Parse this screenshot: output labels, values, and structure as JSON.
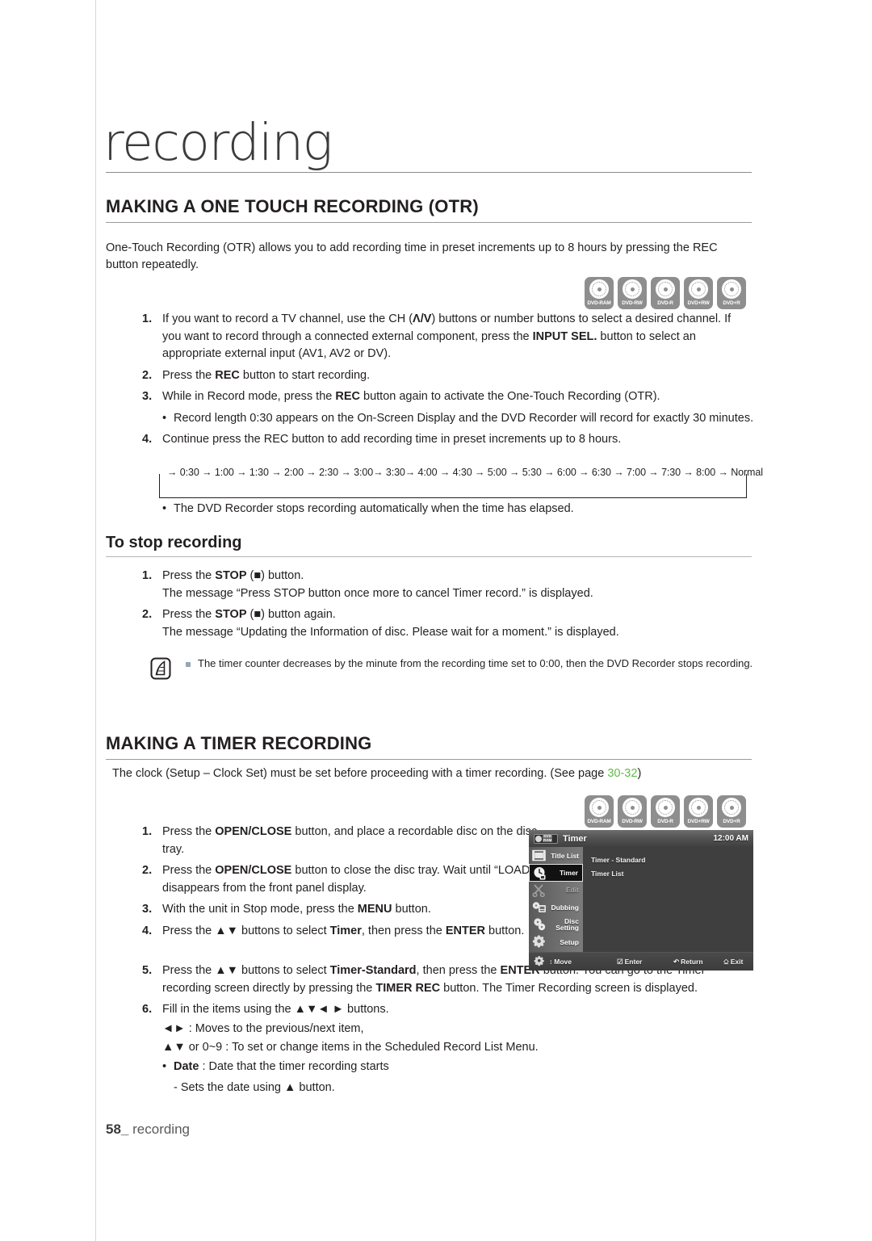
{
  "page": {
    "chapter_title": "recording",
    "footer_page": "58",
    "footer_label": "recording"
  },
  "disc_types": [
    {
      "label": "DVD-RAM"
    },
    {
      "label": "DVD-RW"
    },
    {
      "label": "DVD-R"
    },
    {
      "label": "DVD+RW"
    },
    {
      "label": "DVD+R"
    }
  ],
  "otr": {
    "heading": "MAKING A ONE TOUCH RECORDING (OTR)",
    "intro": "One-Touch Recording (OTR) allows you to add recording time in preset increments up to 8 hours by pressing the REC button repeatedly.",
    "step1_a": "If you want to record a TV channel, use the CH (",
    "step1_ch": "Λ/V",
    "step1_b": ") buttons or number buttons to select a desired channel.  If you want to record through a connected external component, press the ",
    "step1_bold": "INPUT SEL.",
    "step1_c": " button to select an appropriate external input (AV1, AV2 or DV).",
    "step2_a": "Press the ",
    "step2_bold": "REC",
    "step2_b": " button to start recording.",
    "step3_a": "While in Record mode, press the ",
    "step3_bold": "REC",
    "step3_b": " button again to activate the One-Touch Recording (OTR).",
    "step3_bullet": "Record length 0:30 appears on the On-Screen Display and the DVD Recorder will record for exactly 30 minutes.",
    "step4": "Continue press the REC button to add recording time in preset increments up to 8 hours.",
    "step4_bullet": "The DVD Recorder stops recording automatically when the time has elapsed.",
    "sequence": "→ 0:30 → 1:00 → 1:30 → 2:00 → 2:30 → 3:00→ 3:30→ 4:00 → 4:30 → 5:00 → 5:30 → 6:00 → 6:30 → 7:00 → 7:30 → 8:00 → Normal",
    "sequence_values": [
      "0:30",
      "1:00",
      "1:30",
      "2:00",
      "2:30",
      "3:00",
      "3:30",
      "4:00",
      "4:30",
      "5:00",
      "5:30",
      "6:00",
      "6:30",
      "7:00",
      "7:30",
      "8:00",
      "Normal"
    ]
  },
  "stop": {
    "heading": "To stop recording",
    "step1_a": "Press the ",
    "step1_bold": "STOP",
    "step1_b": " (■) button.",
    "step1_line2": "The message “Press STOP button once more to cancel Timer record.” is displayed.",
    "step2_a": "Press the ",
    "step2_bold": "STOP",
    "step2_b": " (■) button again.",
    "step2_line2": "The message “Updating the Information of disc. Please wait for a moment.” is displayed."
  },
  "note": {
    "text": "The timer counter decreases by the minute from the recording time set to 0:00, then the DVD Recorder stops recording."
  },
  "timer": {
    "heading": "MAKING A TIMER RECORDING",
    "intro_a": "The clock (Setup – Clock Set) must be set before proceeding with a timer recording. (See page ",
    "intro_page": "30-32",
    "intro_b": ")",
    "step1_a": "Press the ",
    "step1_bold": "OPEN/CLOSE",
    "step1_b": " button, and place a recordable disc on the disc tray.",
    "step2_a": "Press the ",
    "step2_bold": "OPEN/CLOSE",
    "step2_b": " button to close the disc tray. Wait until “LOAD” disappears from the front panel display.",
    "step3_a": "With the unit in Stop mode, press the ",
    "step3_bold": "MENU",
    "step3_b": " button.",
    "step4_a": "Press the ▲▼ buttons to select ",
    "step4_bold1": "Timer",
    "step4_b": ", then press the ",
    "step4_bold2": "ENTER",
    "step4_c": " button.",
    "step5_a": "Press the ▲▼ buttons to select ",
    "step5_bold1": "Timer-Standard",
    "step5_b": ", then press the ",
    "step5_bold2": "ENTER",
    "step5_c": " button.  You can go to the Timer recording screen directly by pressing the ",
    "step5_bold3": "TIMER REC",
    "step5_d": " button. The Timer Recording screen is displayed.",
    "step6": "Fill in the items using the ▲▼◄ ► buttons.",
    "step6_line1": "◄► : Moves to the previous/next item,",
    "step6_line2": "▲▼ or 0~9 : To set or change items in the Scheduled Record List Menu.",
    "step6_bullet_bold": "Date",
    "step6_bullet_rest": " : Date that the timer recording starts",
    "step6_sub": "- Sets the date using ▲ button."
  },
  "osd": {
    "disc_badge_line1": "DVD",
    "disc_badge_line2": "RAM",
    "title": "Timer",
    "clock": "12:00 AM",
    "sidebar": [
      {
        "label": "Title List",
        "icon": "film-icon",
        "glyph": "▦",
        "state": "normal"
      },
      {
        "label": "Timer",
        "icon": "clock-icon",
        "glyph": "⏱",
        "state": "selected"
      },
      {
        "label": "Edit",
        "icon": "scissors-icon",
        "glyph": "✂",
        "state": "dim"
      },
      {
        "label": "Dubbing",
        "icon": "dubbing-icon",
        "glyph": "⟳",
        "state": "normal"
      },
      {
        "label": "Disc\nSetting",
        "label_l1": "Disc",
        "label_l2": "Setting",
        "icon": "disc-setting-icon",
        "glyph": "◉",
        "state": "normal"
      },
      {
        "label": "Setup",
        "icon": "gear-icon",
        "glyph": "⚙",
        "state": "normal"
      }
    ],
    "main_rows": [
      "Timer - Standard",
      "Timer List"
    ],
    "bottom_hints": [
      {
        "key": "↕",
        "label": "Move"
      },
      {
        "key": "☑",
        "label": "Enter"
      },
      {
        "key": "↶",
        "label": "Return"
      },
      {
        "key": "⎐",
        "label": "Exit"
      }
    ]
  }
}
